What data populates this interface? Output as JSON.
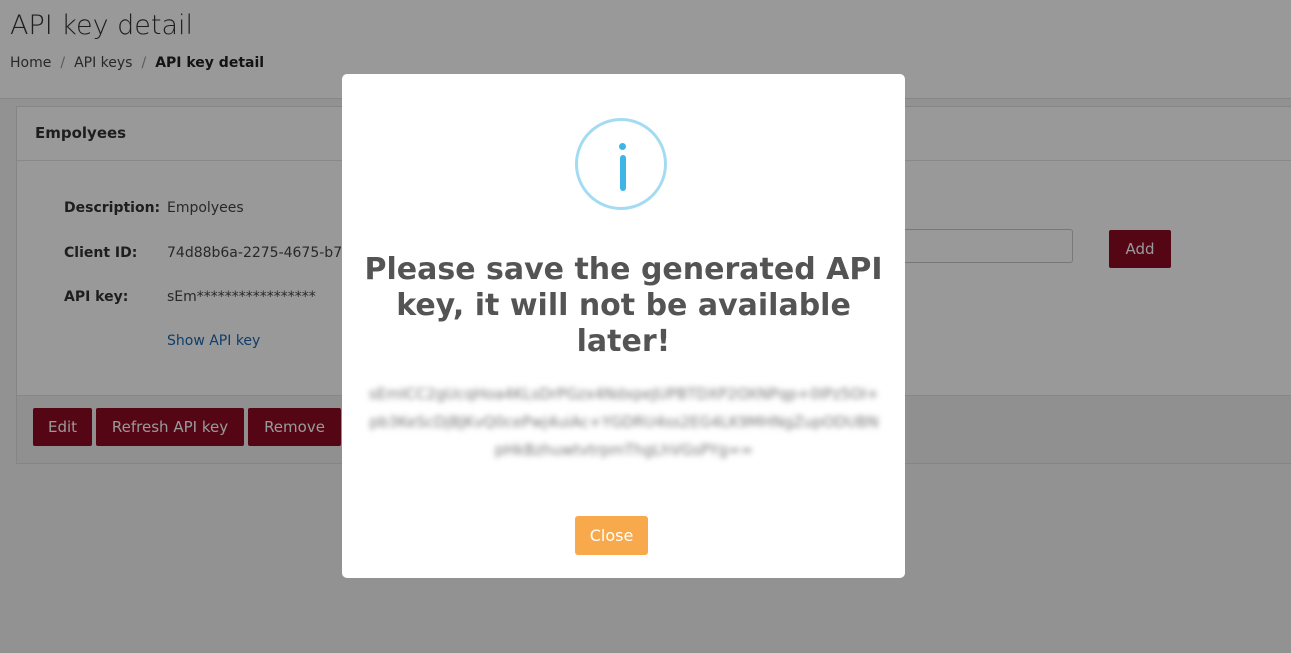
{
  "header": {
    "title": "API key detail",
    "breadcrumb": {
      "home": "Home",
      "api_keys": "API keys",
      "current": "API key detail",
      "separator": "/"
    }
  },
  "card": {
    "title": "Empolyees",
    "fields": {
      "description_label": "Description:",
      "description_value": "Empolyees",
      "client_id_label": "Client ID:",
      "client_id_value": "74d88b6a-2275-4675-b7",
      "api_key_label": "API key:",
      "api_key_value": "sEm*****************"
    },
    "show_api_key_link": "Show API key",
    "add_button": "Add",
    "buttons": {
      "edit": "Edit",
      "refresh": "Refresh API key",
      "remove": "Remove"
    }
  },
  "modal": {
    "icon": "info-icon",
    "title": "Please save the generated API key, it will not be available later!",
    "api_key": "sEmICC2gUcqHoa4KLsDrPGzx4NdxpeJUPBTDXP2OXNPqp+0IPz5OI+pb3KeScDjBJKvQ0cePwj4uiAc+YGDRU4ss2EG4LK9MHNgZupODUBNpHkBzhuwtvtrpmThgLhVGsPYg==",
    "close_button": "Close"
  },
  "colors": {
    "primary_button": "#8c0a24",
    "close_button": "#f8a94b",
    "info_icon": "#3fb5e6",
    "link": "#1c67b1"
  }
}
